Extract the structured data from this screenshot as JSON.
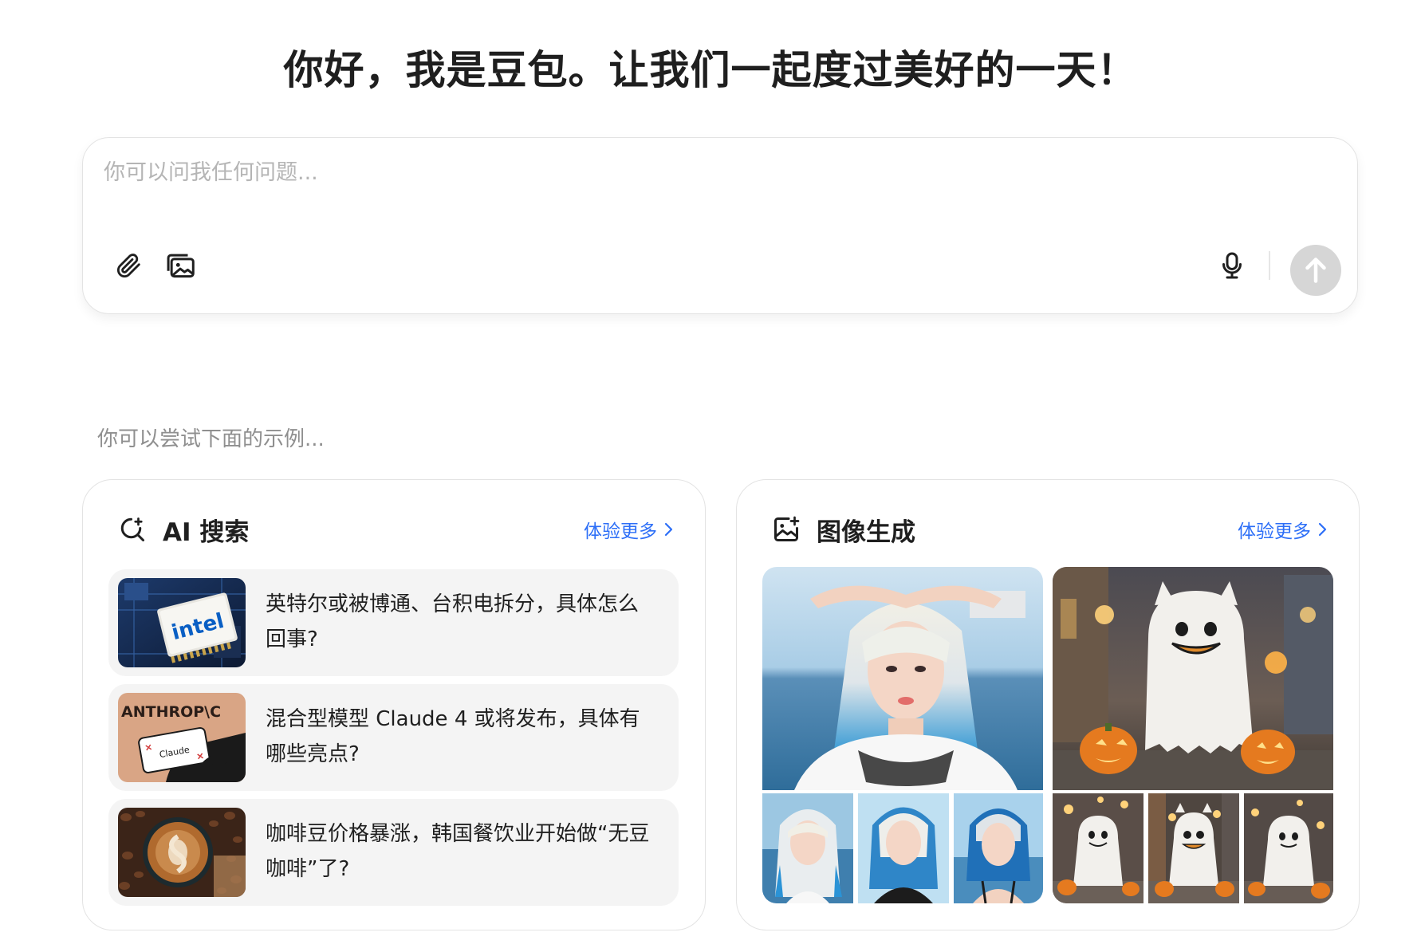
{
  "greeting": "你好，我是豆包。让我们一起度过美好的一天！",
  "chat": {
    "placeholder": "你可以问我任何问题..."
  },
  "examples_hint": "你可以尝试下面的示例...",
  "ai_search": {
    "title": "AI 搜索",
    "more_label": "体验更多",
    "items": [
      {
        "text": "英特尔或被博通、台积电拆分，具体怎么回事?",
        "thumb_label": "intel"
      },
      {
        "text": "混合型模型 Claude 4 或将发布，具体有哪些亮点?",
        "thumb_label": "ANTHROP\\C",
        "thumb_card_label": "Claude"
      },
      {
        "text": "咖啡豆价格暴涨，韩国餐饮业开始做“无豆咖啡”了?"
      }
    ]
  },
  "image_gen": {
    "title": "图像生成",
    "more_label": "体验更多"
  },
  "colors": {
    "accent_link": "#2d6ff7",
    "send_disabled": "#d6d6d6",
    "item_bg": "#f4f4f4"
  },
  "icons": {
    "attach": "paperclip-icon",
    "image_upload": "image-upload-icon",
    "mic": "microphone-icon",
    "send": "arrow-up-icon",
    "search": "ai-search-icon",
    "image_gen": "image-sparkle-icon",
    "more": "chevron-right-icon"
  }
}
